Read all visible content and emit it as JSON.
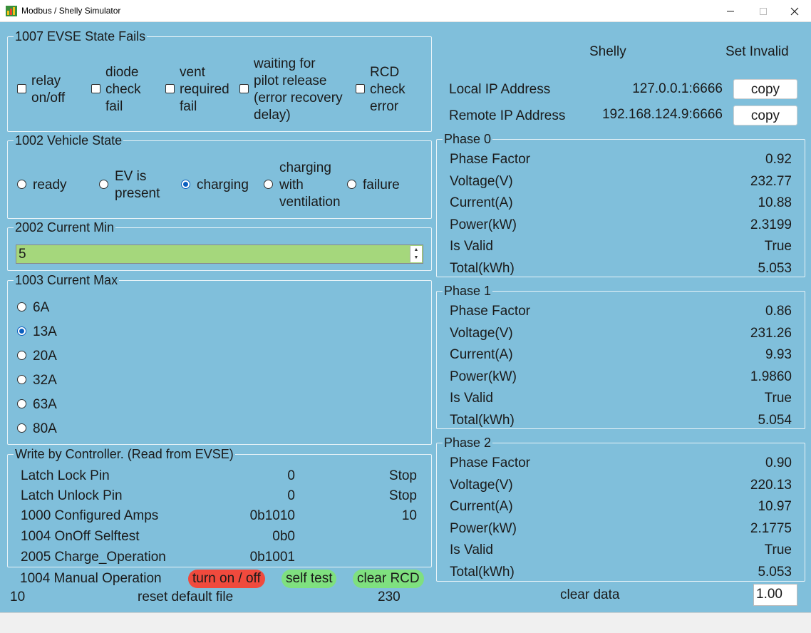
{
  "window": {
    "title": "Modbus / Shelly Simulator"
  },
  "evse_fails": {
    "title": "1007 EVSE State Fails",
    "items": [
      {
        "lines": [
          "relay",
          "on/off"
        ]
      },
      {
        "lines": [
          "diode",
          "check",
          "fail"
        ]
      },
      {
        "lines": [
          "vent",
          "required",
          "fail"
        ]
      },
      {
        "lines": [
          "waiting for",
          "pilot release",
          "(error recovery",
          "delay)"
        ]
      },
      {
        "lines": [
          "RCD",
          "check",
          "error"
        ]
      }
    ]
  },
  "vehicle_state": {
    "title": "1002 Vehicle State",
    "selected": "charging",
    "options": [
      {
        "lines": [
          "ready"
        ]
      },
      {
        "lines": [
          "EV is",
          "present"
        ]
      },
      {
        "lines": [
          "charging"
        ]
      },
      {
        "lines": [
          "charging",
          "with",
          "ventilation"
        ]
      },
      {
        "lines": [
          "failure"
        ]
      }
    ]
  },
  "current_min": {
    "title": "2002 Current Min",
    "value": "5"
  },
  "current_max": {
    "title": "1003 Current Max",
    "selected": "13A",
    "options": [
      "6A",
      "13A",
      "20A",
      "32A",
      "63A",
      "80A"
    ]
  },
  "controller": {
    "title": "Write by Controller. (Read from EVSE)",
    "rows": [
      {
        "name": "Latch Lock Pin",
        "value": "0",
        "extra": "Stop"
      },
      {
        "name": "Latch Unlock Pin",
        "value": "0",
        "extra": "Stop"
      },
      {
        "name": "1000 Configured Amps",
        "value": "0b1010",
        "extra": "10"
      },
      {
        "name": "1004 OnOff Selftest",
        "value": "0b0",
        "extra": ""
      },
      {
        "name": "2005 Charge_Operation",
        "value": "0b1001",
        "extra": ""
      }
    ]
  },
  "manual": {
    "label": "1004 Manual Operation",
    "turn_on_off": "turn on / off",
    "self_test": "self test",
    "clear_rcd": "clear RCD"
  },
  "bottom": {
    "left_value": "10",
    "reset_label": "reset default file",
    "right_value": "230"
  },
  "shelly": {
    "header": "Shelly",
    "set_invalid": "Set Invalid",
    "local_label": "Local IP Address",
    "local_value": "127.0.0.1:6666",
    "remote_label": "Remote IP Address",
    "remote_value": "192.168.124.9:6666",
    "copy_label": "copy"
  },
  "phases": [
    {
      "title": "Phase 0",
      "rows": [
        {
          "name": "Phase Factor",
          "value": "0.92"
        },
        {
          "name": "Voltage(V)",
          "value": "232.77"
        },
        {
          "name": "Current(A)",
          "value": "10.88"
        },
        {
          "name": "Power(kW)",
          "value": "2.3199"
        },
        {
          "name": "Is Valid",
          "value": "True"
        },
        {
          "name": "Total(kWh)",
          "value": "5.053"
        }
      ]
    },
    {
      "title": "Phase 1",
      "rows": [
        {
          "name": "Phase Factor",
          "value": "0.86"
        },
        {
          "name": "Voltage(V)",
          "value": "231.26"
        },
        {
          "name": "Current(A)",
          "value": "9.93"
        },
        {
          "name": "Power(kW)",
          "value": "1.9860"
        },
        {
          "name": "Is Valid",
          "value": "True"
        },
        {
          "name": "Total(kWh)",
          "value": "5.054"
        }
      ]
    },
    {
      "title": "Phase 2",
      "rows": [
        {
          "name": "Phase Factor",
          "value": "0.90"
        },
        {
          "name": "Voltage(V)",
          "value": "220.13"
        },
        {
          "name": "Current(A)",
          "value": "10.97"
        },
        {
          "name": "Power(kW)",
          "value": "2.1775"
        },
        {
          "name": "Is Valid",
          "value": "True"
        },
        {
          "name": "Total(kWh)",
          "value": "5.053"
        }
      ]
    }
  ],
  "clear": {
    "label": "clear data",
    "value": "1.00"
  }
}
